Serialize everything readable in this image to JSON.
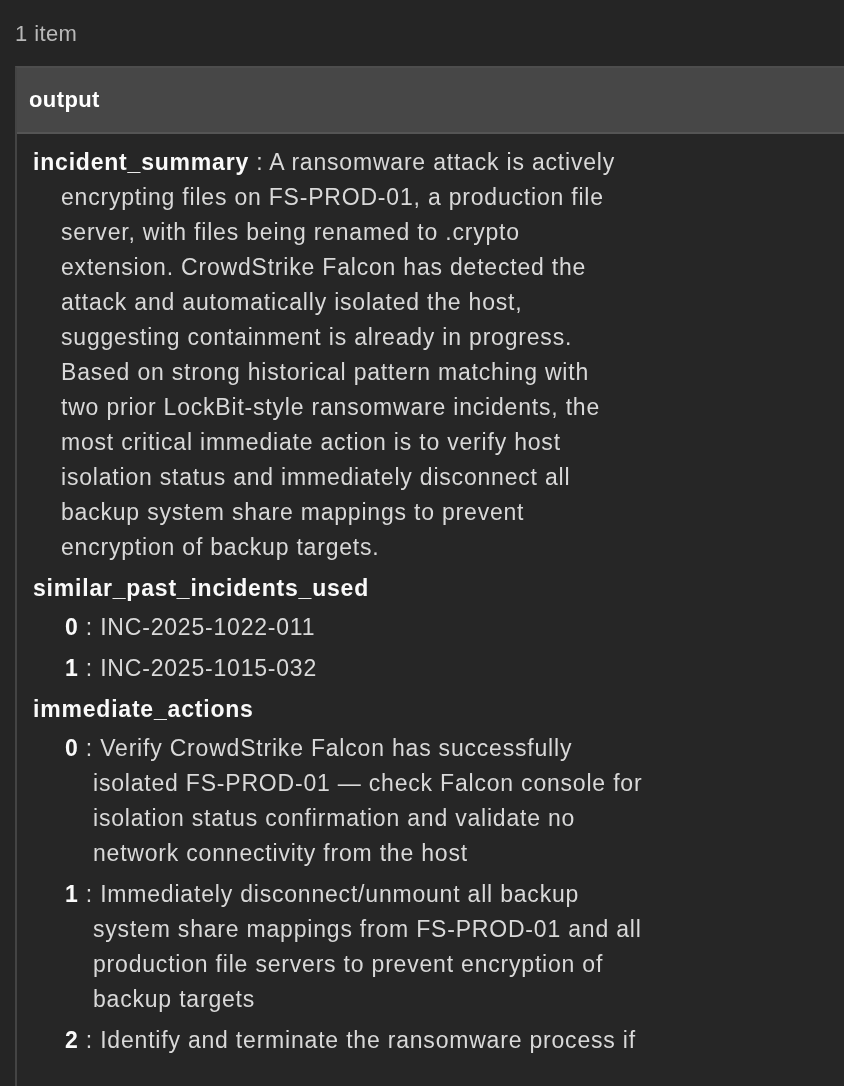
{
  "item_count": "1 item",
  "output": {
    "title": "output",
    "separator": ":",
    "fields": [
      {
        "key": "incident_summary",
        "kind": "text",
        "value": "A ransomware attack is actively encrypting files on FS-PROD-01, a production file server, with files being renamed to .crypto extension. CrowdStrike Falcon has detected the attack and automatically isolated the host, suggesting containment is already in progress. Based on strong historical pattern matching with two prior LockBit-style ransomware incidents, the most critical immediate action is to verify host isolation status and immediately disconnect all backup system share mappings to prevent encryption of backup targets."
      },
      {
        "key": "similar_past_incidents_used",
        "kind": "list",
        "items": [
          {
            "index": "0",
            "value": "INC-2025-1022-011"
          },
          {
            "index": "1",
            "value": "INC-2025-1015-032"
          }
        ]
      },
      {
        "key": "immediate_actions",
        "kind": "list",
        "items": [
          {
            "index": "0",
            "value": "Verify CrowdStrike Falcon has successfully isolated FS-PROD-01 — check Falcon console for isolation status confirmation and validate no network connectivity from the host"
          },
          {
            "index": "1",
            "value": "Immediately disconnect/unmount all backup system share mappings from FS-PROD-01 and all production file servers to prevent encryption of backup targets"
          },
          {
            "index": "2",
            "value": "Identify and terminate the ransomware process if"
          }
        ]
      }
    ]
  }
}
